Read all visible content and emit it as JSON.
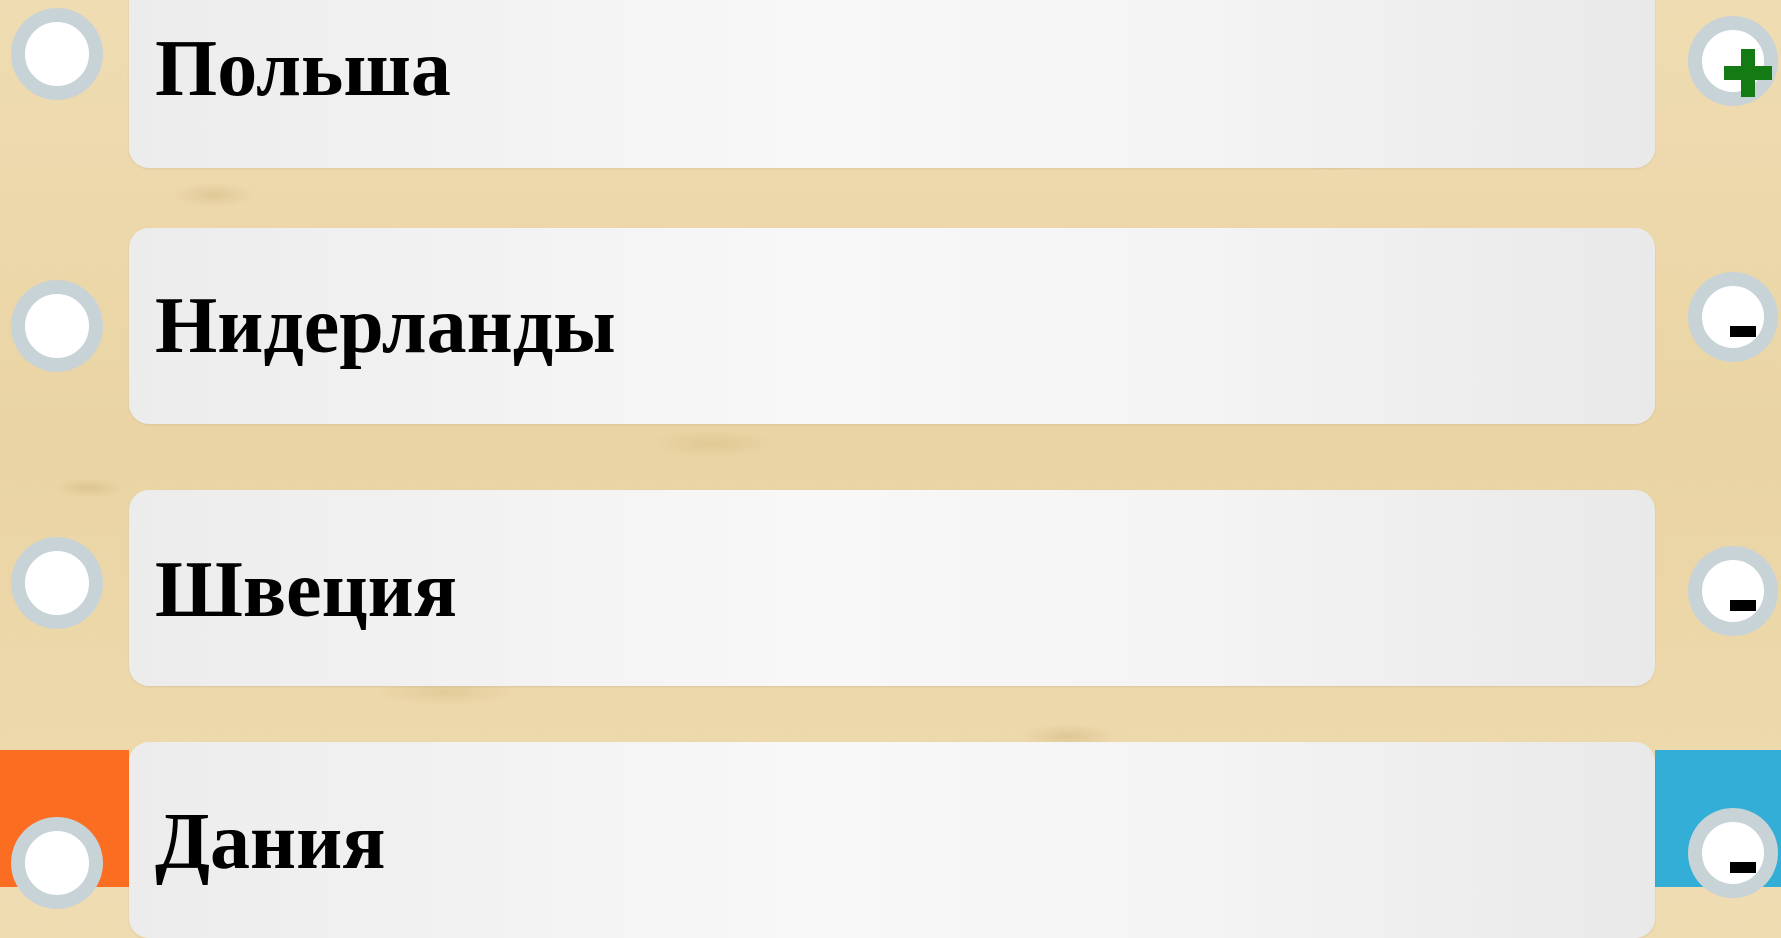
{
  "options": [
    {
      "label": "Польша",
      "status": "+"
    },
    {
      "label": "Нидерланды",
      "status": "-"
    },
    {
      "label": "Швеция",
      "status": "-"
    },
    {
      "label": "Дания",
      "status": "-"
    }
  ],
  "colors": {
    "correct_mark": "#147a14",
    "left_accent": "#fb6d21",
    "right_accent": "#33aed6"
  },
  "icons": {
    "radio": "radio-circle-icon",
    "correct": "plus-icon",
    "wrong": "minus-icon"
  }
}
